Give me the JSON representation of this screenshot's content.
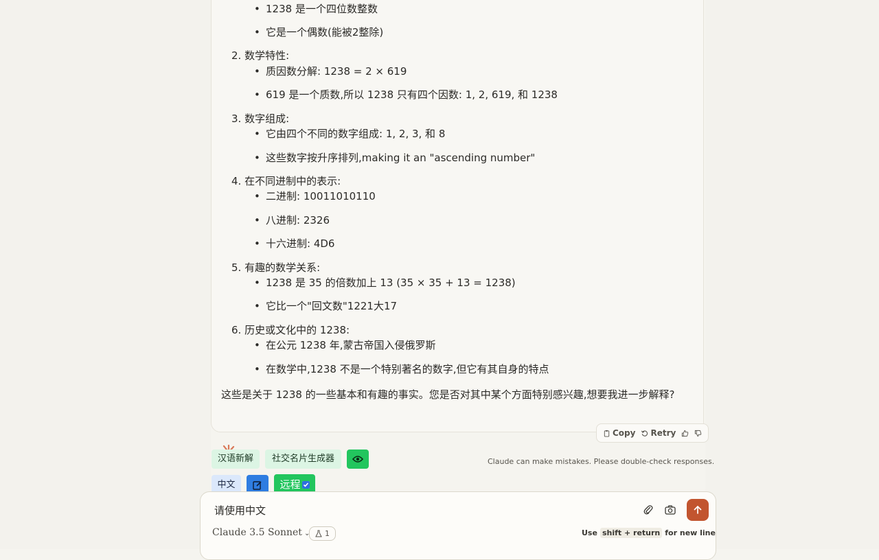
{
  "message": {
    "top_items": [
      "1238 是一个四位数整数",
      "它是一个偶数(能被2整除)"
    ],
    "sections": [
      {
        "title": "2. 数学特性:",
        "items": [
          "质因数分解: 1238 = 2 × 619",
          "619 是一个质数,所以 1238 只有四个因数: 1, 2, 619, 和 1238"
        ]
      },
      {
        "title": "3. 数字组成:",
        "items": [
          "它由四个不同的数字组成: 1, 2, 3, 和 8",
          "这些数字按升序排列,making it an \"ascending number\""
        ]
      },
      {
        "title": "4. 在不同进制中的表示:",
        "items": [
          "二进制: 10011010110",
          "八进制: 2326",
          "十六进制: 4D6"
        ]
      },
      {
        "title": "5. 有趣的数学关系:",
        "items": [
          "1238 是 35 的倍数加上 13 (35 × 35 + 13 = 1238)",
          "它比一个\"回文数\"1221大17"
        ]
      },
      {
        "title": "6. 历史或文化中的 1238:",
        "items": [
          "在公元 1238 年,蒙古帝国入侵俄罗斯",
          "在数学中,1238 不是一个特别著名的数字,但它有其自身的特点"
        ]
      }
    ],
    "closing": "这些是关于 1238 的一些基本和有趣的事实。您是否对其中某个方面特别感兴趣,想要我进一步解释?"
  },
  "actions": {
    "copy": "Copy",
    "retry": "Retry",
    "icons": [
      "copy-icon",
      "retry-icon",
      "thumbs-up-icon",
      "thumbs-down-icon"
    ]
  },
  "disclaimer": "Claude can make mistakes. Please double-check responses.",
  "toolbar": {
    "chip1": "汉语新解",
    "chip2": "社交名片生成器",
    "lang": "中文",
    "remote": "远程",
    "icons": [
      "eye-icon",
      "edit-icon"
    ]
  },
  "composer": {
    "input_value": "请使用中文",
    "model": "Claude 3.5 Sonnet",
    "tools_count": "1",
    "hint_pre": "Use",
    "hint_key": "shift + return",
    "hint_post": "for new line",
    "icons": [
      "paperclip-icon",
      "camera-icon",
      "send-arrow-icon",
      "flask-icon",
      "chevron-down-icon"
    ]
  },
  "colors": {
    "accent": "#c2552f",
    "green": "#22c55e",
    "blue": "#2f7de1",
    "background": "#f5f4ef"
  }
}
